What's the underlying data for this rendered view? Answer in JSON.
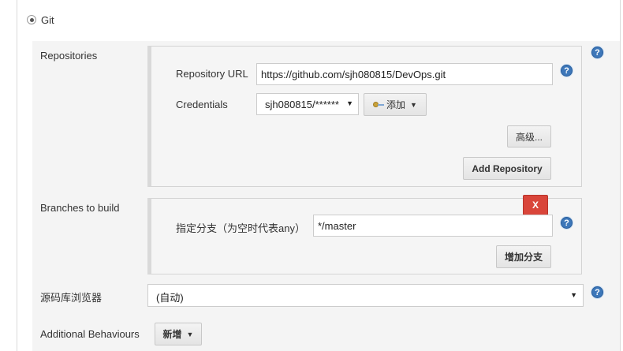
{
  "scm": {
    "option_label": "Git",
    "top_fragment": "“​"
  },
  "repositories": {
    "section_label": "Repositories",
    "url_label": "Repository URL",
    "url_value": "https://github.com/sjh080815/DevOps.git",
    "credentials_label": "Credentials",
    "credentials_value": "sjh080815/******",
    "add_button_label": "添加",
    "advanced_button_label": "高级...",
    "add_repository_label": "Add Repository"
  },
  "branches": {
    "section_label": "Branches to build",
    "delete_label": "X",
    "branch_spec_label": "指定分支（为空时代表any）",
    "branch_spec_value": "*/master",
    "add_branch_label": "增加分支"
  },
  "repo_browser": {
    "label": "源码库浏览器",
    "selected": "(自动)"
  },
  "behaviours": {
    "label": "Additional Behaviours",
    "add_label": "新增"
  },
  "help_icon_text": "?",
  "colors": {
    "help_blue": "#3d77b9",
    "delete_red": "#d9453a",
    "panel_bg": "#f4f4f4"
  }
}
